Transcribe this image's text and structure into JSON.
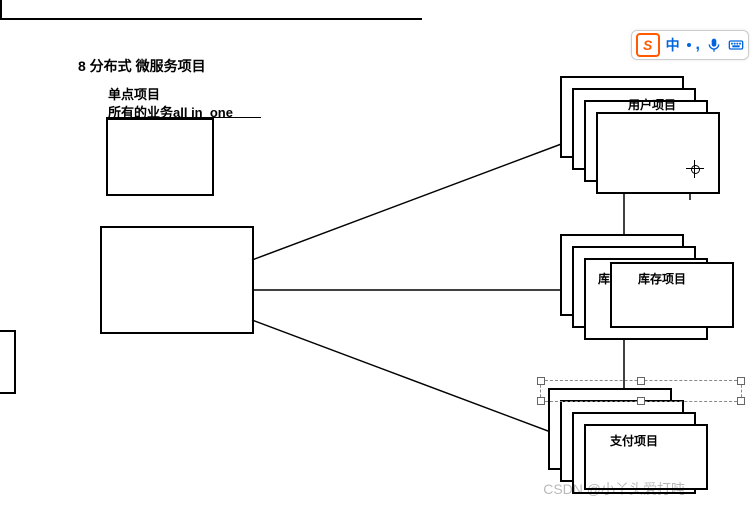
{
  "title": "8 分布式  微服务项目",
  "monolith": {
    "heading": "单点项目",
    "subheading": "所有的业务all in_one"
  },
  "clusters": {
    "user": "用户项目",
    "inventory_short": "库",
    "inventory": "库存项目",
    "payment": "支付项目"
  },
  "ime": {
    "lang": "中",
    "logo": "S"
  },
  "watermark": "CSDN @小丫头爱打吨"
}
